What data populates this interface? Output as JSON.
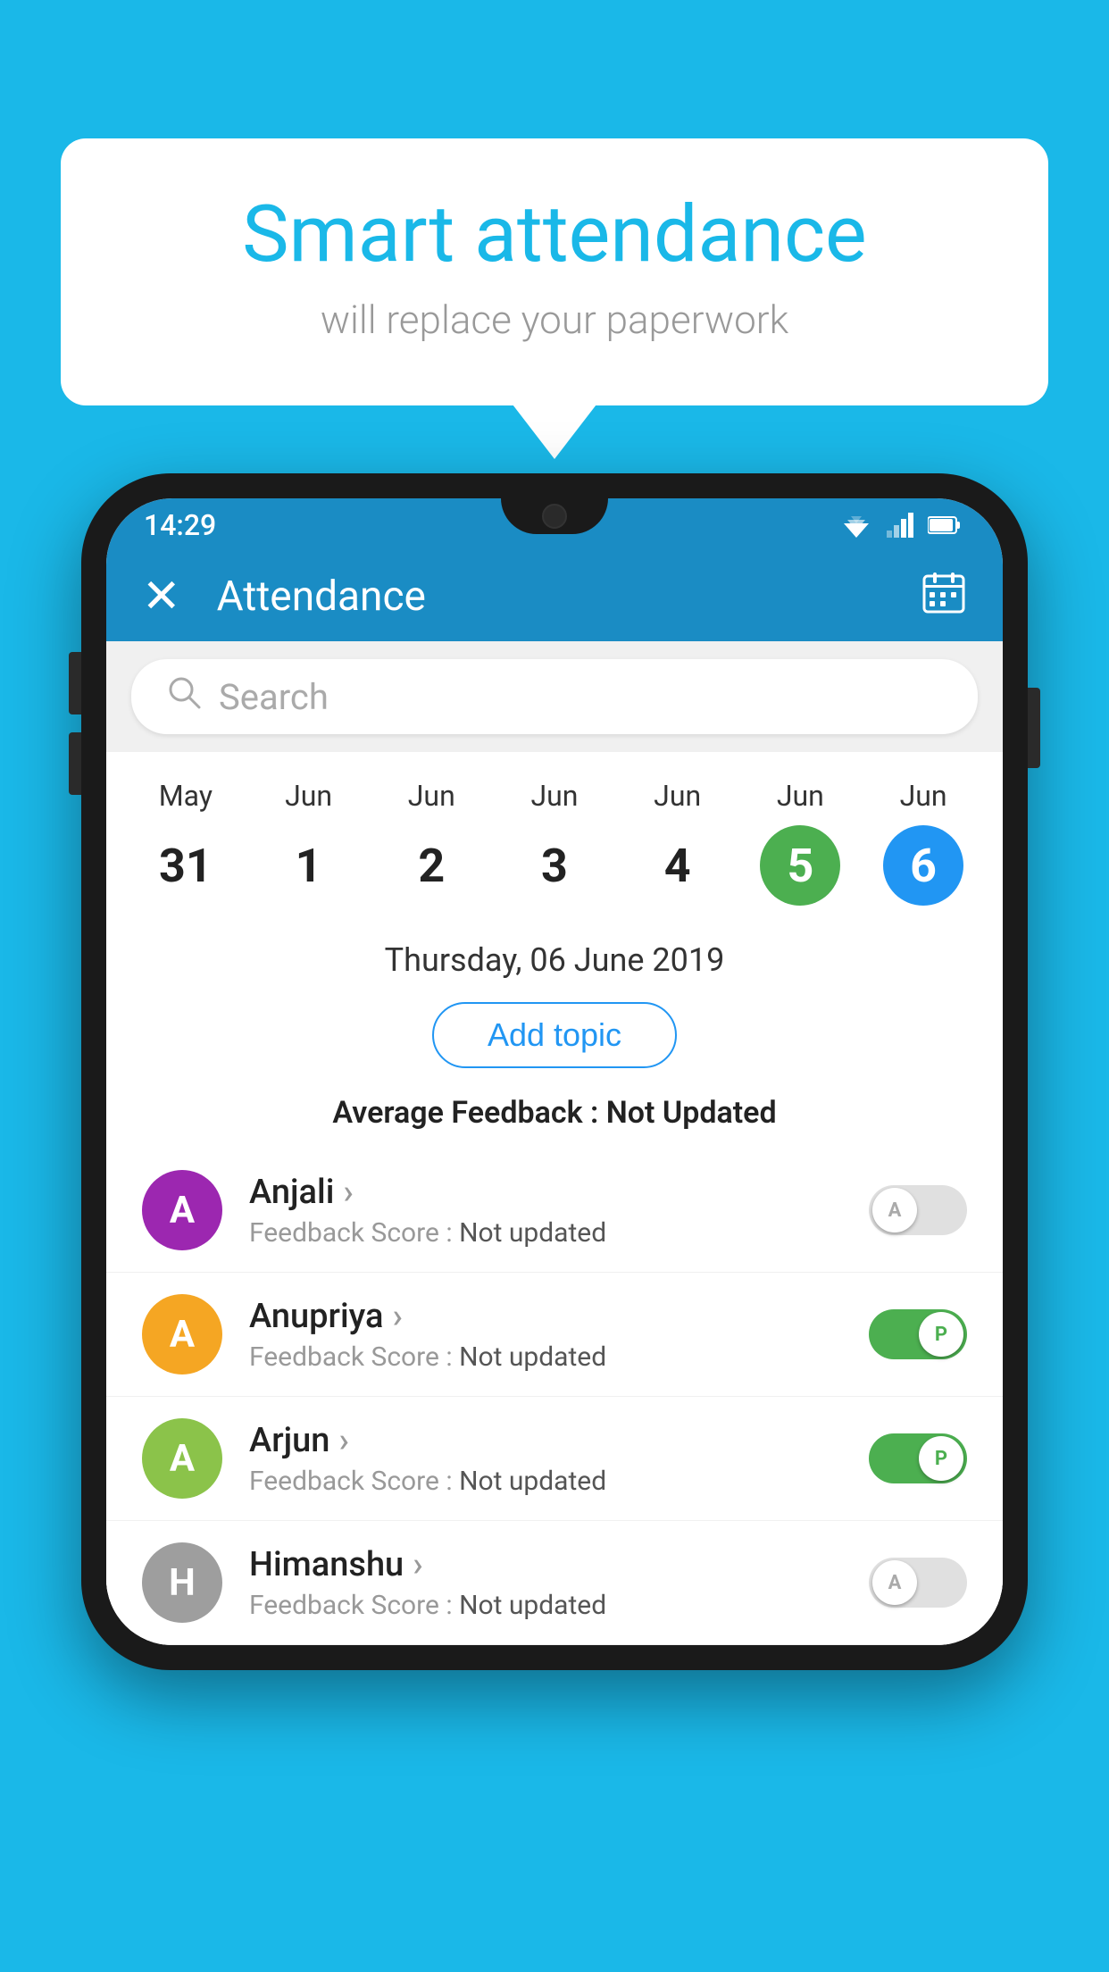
{
  "background": {
    "color": "#1ab8e8"
  },
  "speech_bubble": {
    "title": "Smart attendance",
    "subtitle": "will replace your paperwork"
  },
  "phone": {
    "status_bar": {
      "time": "14:29"
    },
    "app_bar": {
      "close_label": "✕",
      "title": "Attendance",
      "calendar_icon": "📅"
    },
    "search": {
      "placeholder": "Search"
    },
    "calendar": {
      "days": [
        {
          "month": "May",
          "date": "31",
          "type": "normal"
        },
        {
          "month": "Jun",
          "date": "1",
          "type": "normal"
        },
        {
          "month": "Jun",
          "date": "2",
          "type": "normal"
        },
        {
          "month": "Jun",
          "date": "3",
          "type": "normal"
        },
        {
          "month": "Jun",
          "date": "4",
          "type": "normal"
        },
        {
          "month": "Jun",
          "date": "5",
          "type": "today"
        },
        {
          "month": "Jun",
          "date": "6",
          "type": "selected"
        }
      ]
    },
    "selected_date": "Thursday, 06 June 2019",
    "add_topic_label": "Add topic",
    "avg_feedback_label": "Average Feedback : ",
    "avg_feedback_value": "Not Updated",
    "students": [
      {
        "name": "Anjali",
        "avatar_letter": "A",
        "avatar_color": "#9c27b0",
        "feedback_label": "Feedback Score : ",
        "feedback_value": "Not updated",
        "toggle": "off",
        "toggle_letter": "A"
      },
      {
        "name": "Anupriya",
        "avatar_letter": "A",
        "avatar_color": "#f5a623",
        "feedback_label": "Feedback Score : ",
        "feedback_value": "Not updated",
        "toggle": "on",
        "toggle_letter": "P"
      },
      {
        "name": "Arjun",
        "avatar_letter": "A",
        "avatar_color": "#8bc34a",
        "feedback_label": "Feedback Score : ",
        "feedback_value": "Not updated",
        "toggle": "on",
        "toggle_letter": "P"
      },
      {
        "name": "Himanshu",
        "avatar_letter": "H",
        "avatar_color": "#9e9e9e",
        "feedback_label": "Feedback Score : ",
        "feedback_value": "Not updated",
        "toggle": "off",
        "toggle_letter": "A"
      }
    ]
  }
}
